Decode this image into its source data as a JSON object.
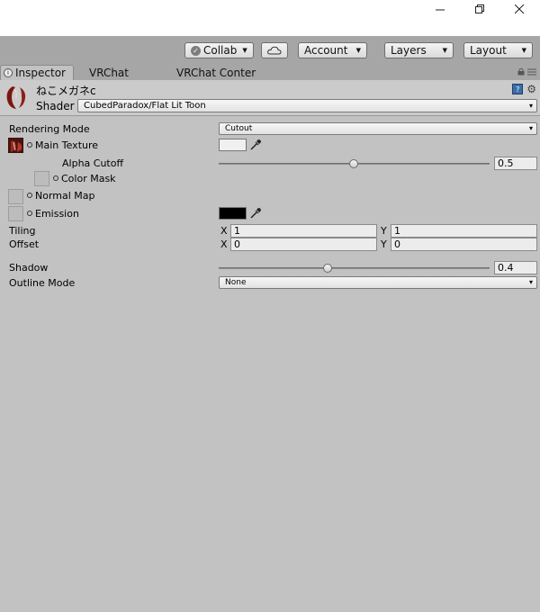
{
  "window": {
    "controls": [
      "minimize-icon",
      "restore-icon",
      "close-icon"
    ]
  },
  "toolbar": {
    "collab_label": "Collab",
    "account_label": "Account",
    "layers_label": "Layers",
    "layout_label": "Layout"
  },
  "tabs": [
    {
      "label": "Inspector",
      "active": true
    },
    {
      "label": "VRChat",
      "active": false
    },
    {
      "label": "VRChat Conter",
      "active": false
    }
  ],
  "material": {
    "name": "ねこメガネc",
    "shader_label": "Shader",
    "shader_value": "CubedParadox/Flat Lit Toon"
  },
  "properties": {
    "rendering_mode": {
      "label": "Rendering Mode",
      "value": "Cutout"
    },
    "main_texture": {
      "label": "Main Texture",
      "color": "#f0f0f0"
    },
    "alpha_cutoff": {
      "label": "Alpha Cutoff",
      "value": "0.5",
      "fraction": 0.5
    },
    "color_mask": {
      "label": "Color Mask"
    },
    "normal_map": {
      "label": "Normal Map"
    },
    "emission": {
      "label": "Emission",
      "color": "#000000"
    },
    "tiling": {
      "label": "Tiling",
      "x_label": "X",
      "x": "1",
      "y_label": "Y",
      "y": "1"
    },
    "offset": {
      "label": "Offset",
      "x_label": "X",
      "x": "0",
      "y_label": "Y",
      "y": "0"
    },
    "shadow": {
      "label": "Shadow",
      "value": "0.4",
      "fraction": 0.4
    },
    "outline_mode": {
      "label": "Outline Mode",
      "value": "None"
    }
  },
  "colors": {
    "panel_bg": "#c2c2c2",
    "toolbar_bg": "#a6a6a6"
  }
}
